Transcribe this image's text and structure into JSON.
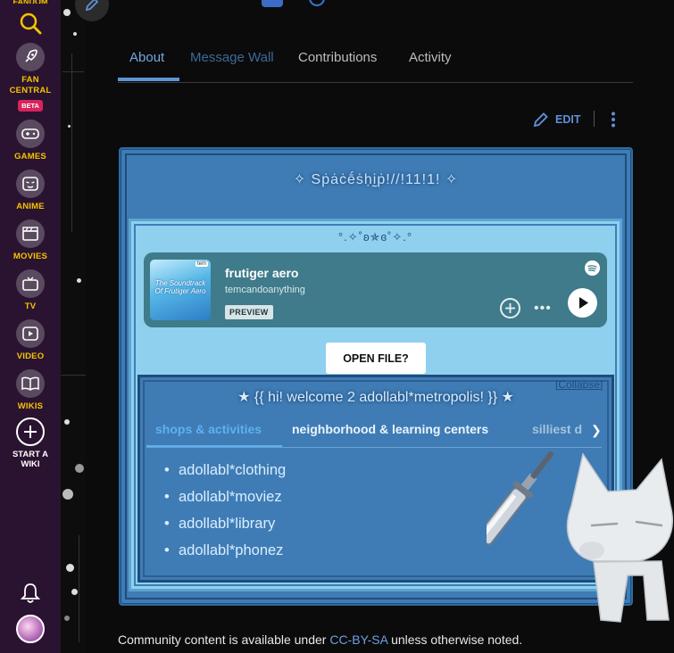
{
  "rail": {
    "brand": "FANDOM",
    "items": [
      {
        "label": "FAN CENTRAL",
        "icon": "rocket-icon",
        "badge": "BETA"
      },
      {
        "label": "GAMES",
        "icon": "gamepad-icon"
      },
      {
        "label": "ANIME",
        "icon": "anime-face-icon"
      },
      {
        "label": "MOVIES",
        "icon": "clapperboard-icon"
      },
      {
        "label": "TV",
        "icon": "tv-icon"
      },
      {
        "label": "VIDEO",
        "icon": "play-icon"
      },
      {
        "label": "WIKIS",
        "icon": "book-icon"
      }
    ],
    "start_wiki": "START A WIKI"
  },
  "tabs": [
    {
      "label": "About",
      "active": true
    },
    {
      "label": "Message Wall"
    },
    {
      "label": "Contributions"
    },
    {
      "label": "Activity"
    }
  ],
  "toolbar": {
    "edit_label": "EDIT"
  },
  "profile": {
    "title": "✧ Sṗȧċḗṡḥḭṗ!//!11!1! ✧",
    "deco": "°.✧˚ʚ✯ɞ˚✧.°",
    "spotify": {
      "track": "frutiger aero",
      "artist": "temcandoanything",
      "preview_label": "PREVIEW",
      "album_text": "The Soundtrack Of Frutiger Aero",
      "album_tag": "tem"
    },
    "open_file": "OPEN FILE?",
    "collapse": "[Collapse]",
    "welcome_title": "★ {{ hi! welcome 2 adollabl*metropolis! }} ★",
    "welcome_tabs": [
      {
        "label": "shops & activities",
        "active": true
      },
      {
        "label": "neighborhood & learning centers"
      },
      {
        "label": "silliest d"
      }
    ],
    "list": [
      "adollabl*clothing",
      "adollabl*moviez",
      "adollabl*library",
      "adollabl*phonez"
    ]
  },
  "footer": {
    "before": "Community content is available under ",
    "link": "CC-BY-SA",
    "after": " unless otherwise noted."
  },
  "colors": {
    "rail_bg": "#2a1330",
    "rail_label": "#f5c400",
    "accent_tab": "#73a9e0",
    "box_blue": "#3f7cb5",
    "light_panel": "#8fd0ef",
    "spotify_bg": "#3f7b8a"
  }
}
